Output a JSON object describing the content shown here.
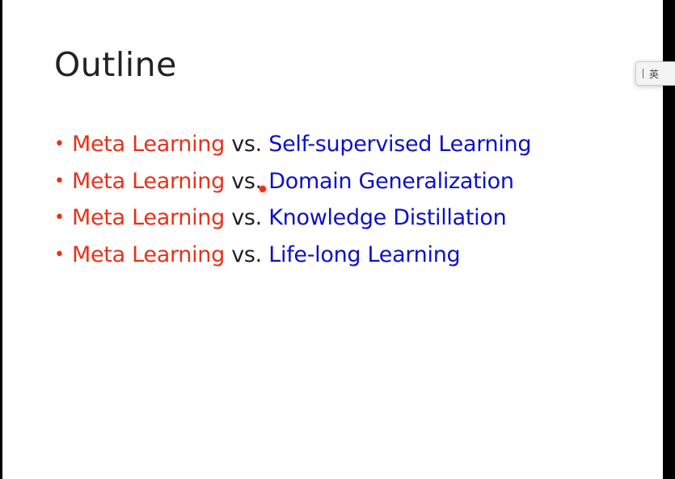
{
  "slide": {
    "title": "Outline",
    "bullets": [
      {
        "left": "Meta Learning",
        "vs": "vs.",
        "right": "Self-supervised Learning"
      },
      {
        "left": "Meta Learning",
        "vs": "vs.",
        "right": "Domain Generalization"
      },
      {
        "left": "Meta Learning",
        "vs": "vs.",
        "right": "Knowledge Distillation"
      },
      {
        "left": "Meta Learning",
        "vs": "vs.",
        "right": "Life-long Learning"
      }
    ],
    "bullet_glyph": "•"
  },
  "ime_indicator": {
    "glyph": "英"
  },
  "colors": {
    "red": "#e8311a",
    "blue": "#0e10c8",
    "text": "#222222"
  }
}
